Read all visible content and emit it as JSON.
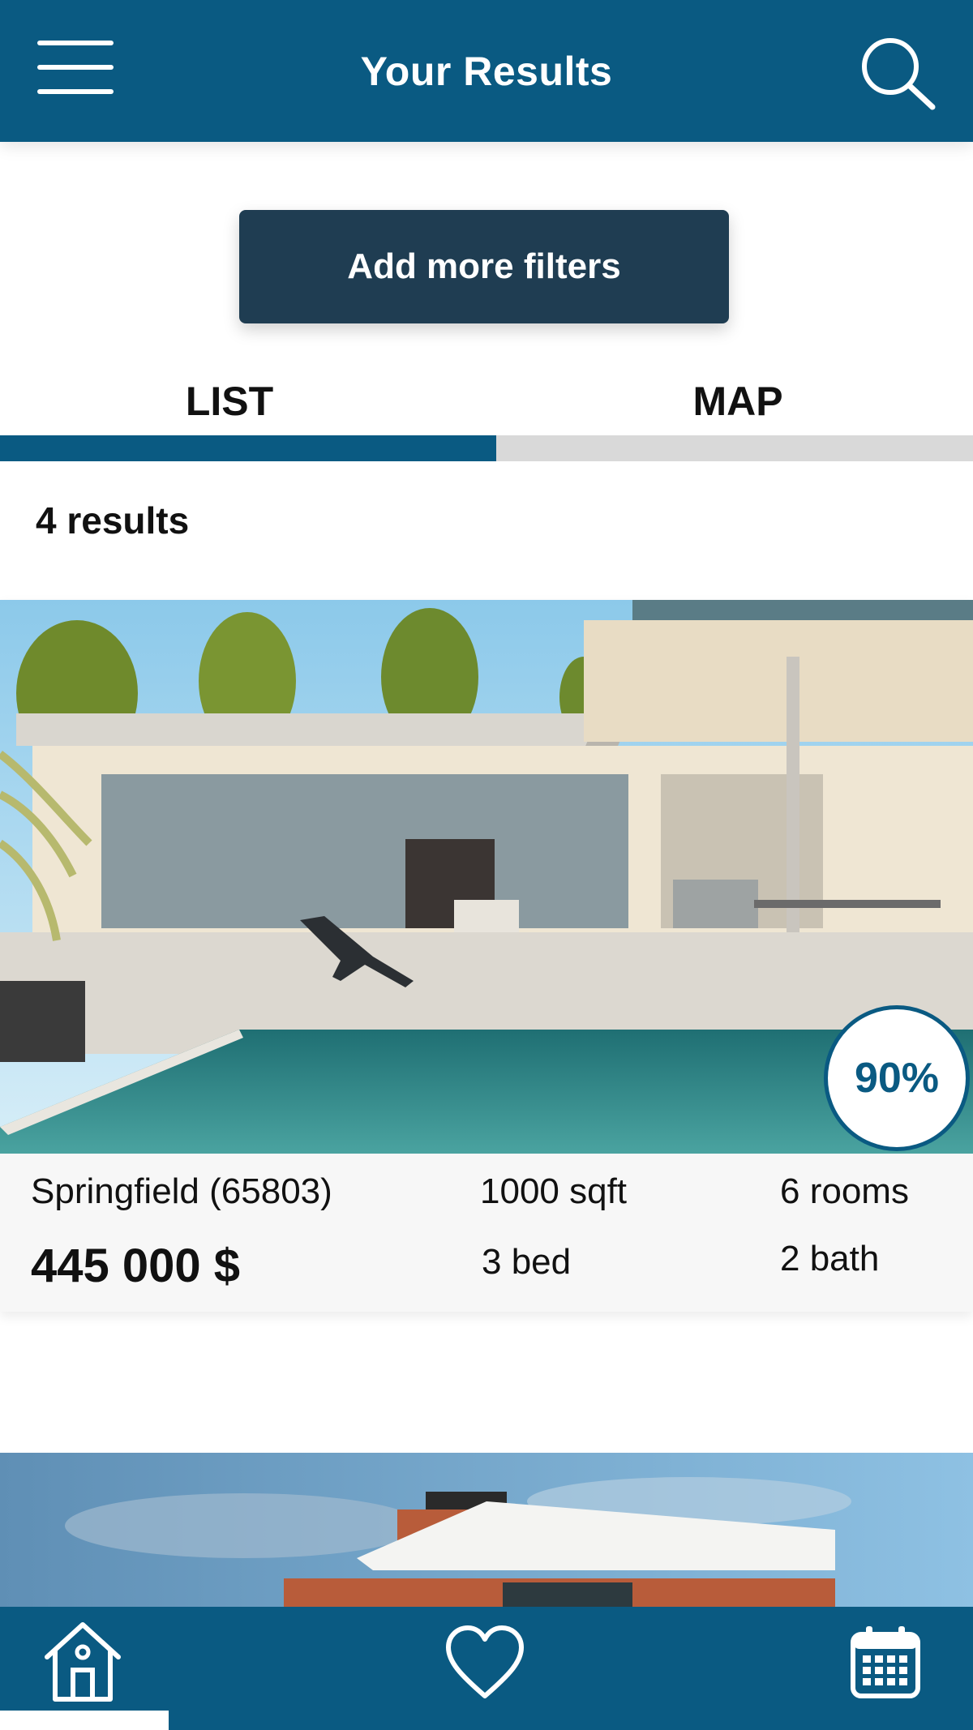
{
  "header": {
    "title": "Your Results",
    "menu_icon": "hamburger-menu-icon",
    "search_icon": "search-icon"
  },
  "filters": {
    "button_label": "Add more filters"
  },
  "tabs": [
    {
      "label": "LIST",
      "active": true
    },
    {
      "label": "MAP",
      "active": false
    }
  ],
  "results": {
    "count_label": "4 results",
    "listings": [
      {
        "location": "Springfield (65803)",
        "price": "445 000 $",
        "area": "1000 sqft",
        "bedrooms": "3 bed",
        "rooms": "6 rooms",
        "bathrooms": "2 bath",
        "match": "90%"
      }
    ]
  },
  "bottom_nav": [
    {
      "icon": "home-icon"
    },
    {
      "icon": "heart-icon"
    },
    {
      "icon": "calendar-icon"
    }
  ],
  "colors": {
    "primary": "#0a5a82",
    "button_dark": "#1f3d52",
    "tab_inactive": "#d9d9d9",
    "card_bg": "#f7f7f7"
  }
}
